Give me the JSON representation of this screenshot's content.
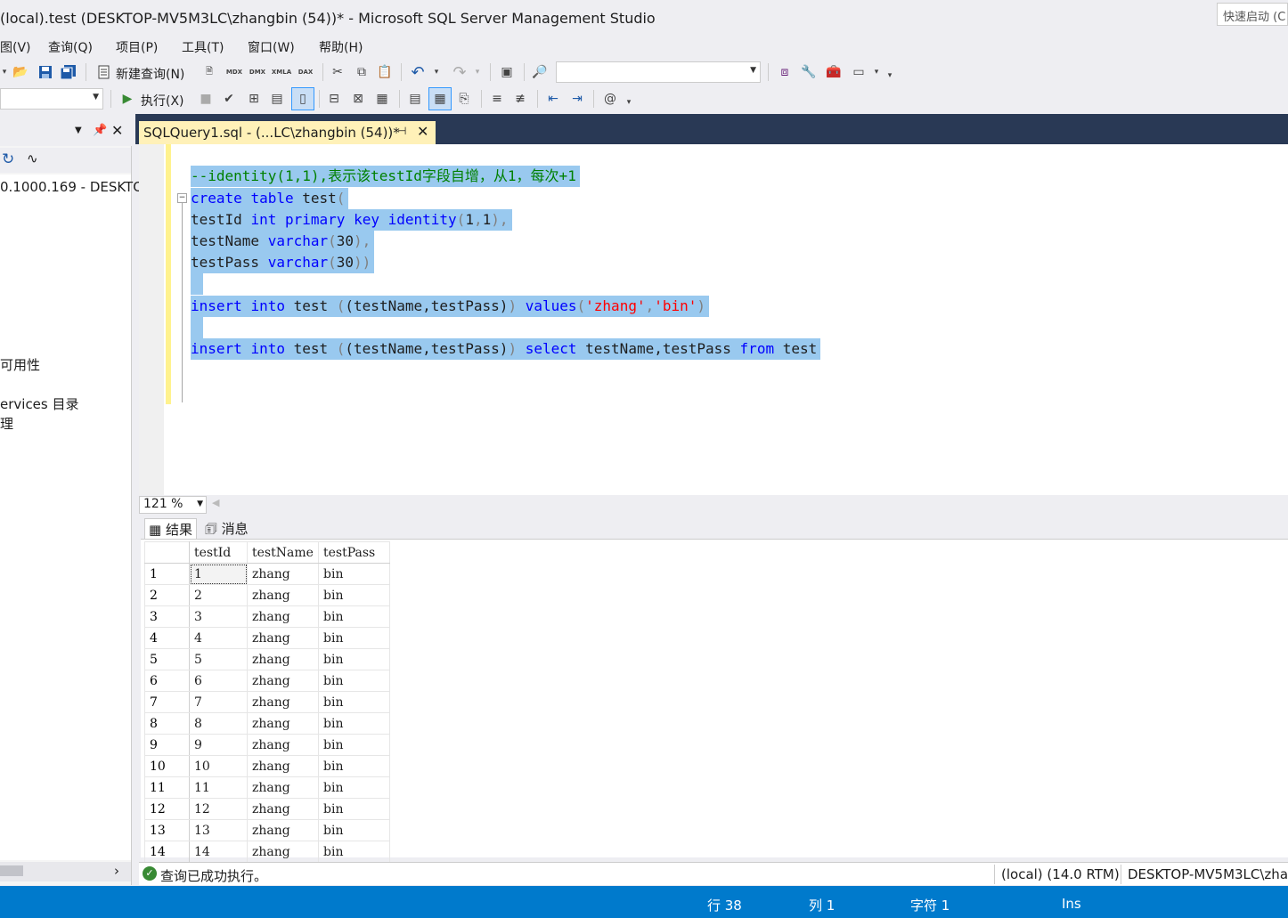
{
  "window": {
    "title": "(local).test (DESKTOP-MV5M3LC\\zhangbin (54))* - Microsoft SQL Server Management Studio",
    "quick_launch_placeholder": "快速启动 (C"
  },
  "menu": {
    "items": [
      "图(V)",
      "查询(Q)",
      "项目(P)",
      "工具(T)",
      "窗口(W)",
      "帮助(H)"
    ]
  },
  "toolbar1": {
    "new_query_label": "新建查询(N)",
    "solution_combo_value": ""
  },
  "toolbar2": {
    "database_combo_value": "",
    "execute_label": "执行(X)"
  },
  "object_explorer": {
    "server_node": "0.1000.169 - DESKTO",
    "item_availability": "可用性",
    "item_services": "ervices 目录",
    "item_mgmt": "理"
  },
  "editor": {
    "tab_label": "SQLQuery1.sql - (...LC\\zhangbin (54))*",
    "lines": {
      "l1_comment": "--identity(1,1),表示该testId字段自增，从1，每次+1",
      "l2_create": "create",
      "l2_table": "table",
      "l2_name": " test",
      "l2_paren": "(",
      "l3_col": "testId ",
      "l3_int": "int",
      "l3_primary": "primary",
      "l3_key": "key",
      "l3_identity": "identity",
      "l3_args_open": "(",
      "l3_args": "1",
      "l3_comma": ",",
      "l3_args2": "1",
      "l3_close": "),",
      "l4_col": "testName ",
      "l4_type": "varchar",
      "l4_open": "(",
      "l4_len": "30",
      "l4_close": "),",
      "l5_col": "testPass ",
      "l5_type": "varchar",
      "l5_open": "(",
      "l5_len": "30",
      "l5_close": "))",
      "l7_insert": "insert",
      "l7_into": "into",
      "l7_table": " test ",
      "l7_cols": "(testName,testPass)",
      "l7_values": "values",
      "l7_open": "(",
      "l7_v1": "'zhang'",
      "l7_comma": ",",
      "l7_v2": "'bin'",
      "l7_close": ")",
      "l9_insert": "insert",
      "l9_into": "into",
      "l9_table": " test ",
      "l9_cols": "(testName,testPass)",
      "l9_select": "select",
      "l9_fields": " testName,testPass ",
      "l9_from": "from",
      "l9_src": " test"
    }
  },
  "zoom": {
    "value": "121 %"
  },
  "results": {
    "tab_results": "结果",
    "tab_messages": "消息",
    "columns": [
      "testId",
      "testName",
      "testPass"
    ],
    "rows": [
      [
        "1",
        "1",
        "zhang",
        "bin"
      ],
      [
        "2",
        "2",
        "zhang",
        "bin"
      ],
      [
        "3",
        "3",
        "zhang",
        "bin"
      ],
      [
        "4",
        "4",
        "zhang",
        "bin"
      ],
      [
        "5",
        "5",
        "zhang",
        "bin"
      ],
      [
        "6",
        "6",
        "zhang",
        "bin"
      ],
      [
        "7",
        "7",
        "zhang",
        "bin"
      ],
      [
        "8",
        "8",
        "zhang",
        "bin"
      ],
      [
        "9",
        "9",
        "zhang",
        "bin"
      ],
      [
        "10",
        "10",
        "zhang",
        "bin"
      ],
      [
        "11",
        "11",
        "zhang",
        "bin"
      ],
      [
        "12",
        "12",
        "zhang",
        "bin"
      ],
      [
        "13",
        "13",
        "zhang",
        "bin"
      ],
      [
        "14",
        "14",
        "zhang",
        "bin"
      ]
    ]
  },
  "query_status": {
    "message": "查询已成功执行。",
    "server": "(local) (14.0 RTM)",
    "user": "DESKTOP-MV5M3LC\\zha"
  },
  "statusbar": {
    "line": "行 38",
    "col": "列 1",
    "char": "字符 1",
    "mode": "Ins"
  },
  "colors": {
    "accent": "#007acc",
    "tab_active": "#fff1b8",
    "selection": "#99c9ef",
    "keyword": "#0000ff",
    "comment": "#008000",
    "string": "#ff0000"
  }
}
